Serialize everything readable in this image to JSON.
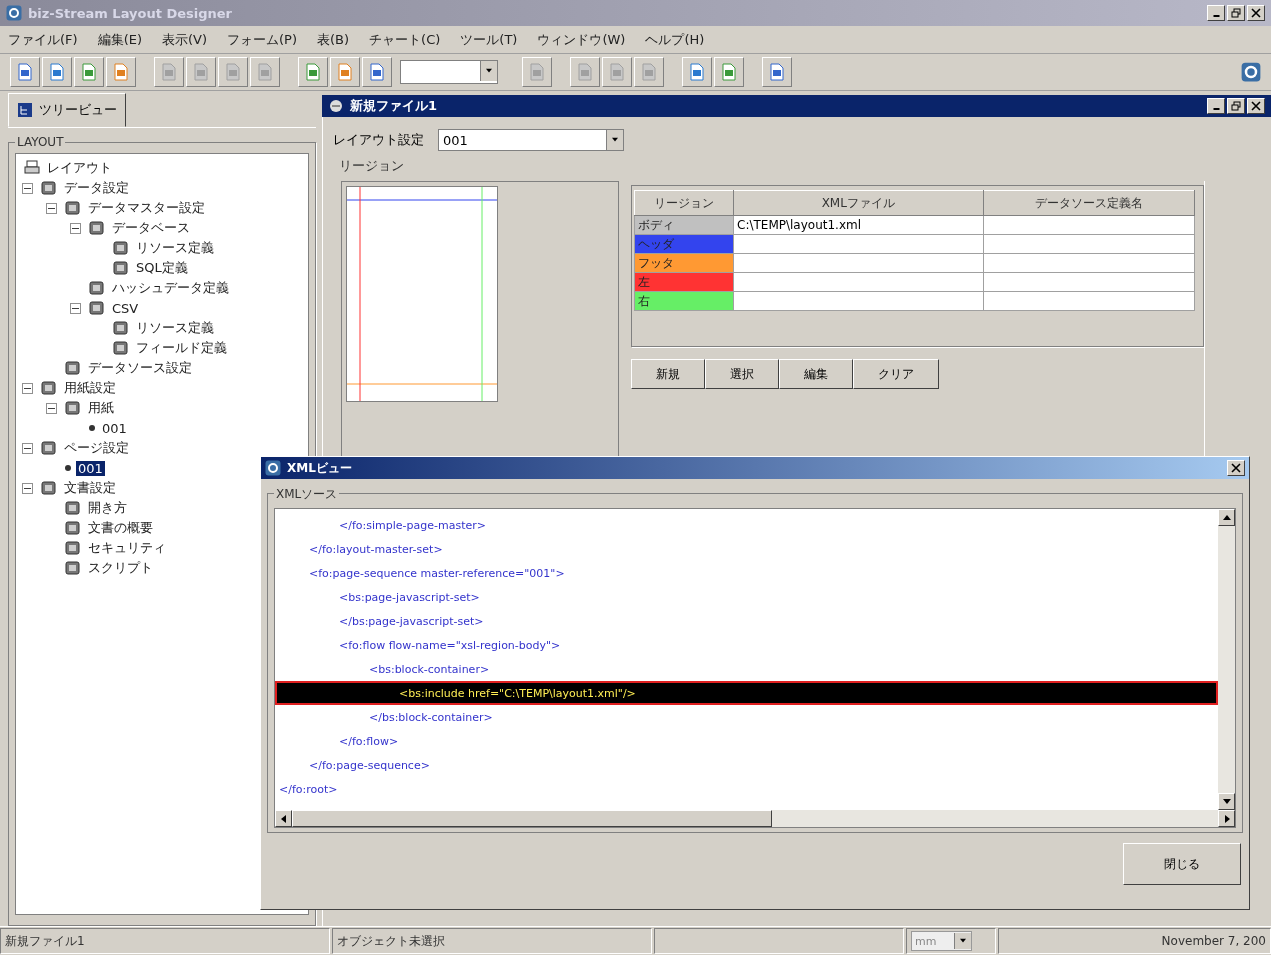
{
  "window": {
    "title": "biz-Stream Layout Designer"
  },
  "menu": [
    "ファイル(F)",
    "編集(E)",
    "表示(V)",
    "フォーム(P)",
    "表(B)",
    "チャート(C)",
    "ツール(T)",
    "ウィンドウ(W)",
    "ヘルプ(H)"
  ],
  "toolbar": [
    {
      "kind": "button",
      "disabled": false
    },
    {
      "kind": "button",
      "disabled": false
    },
    {
      "kind": "button",
      "disabled": false
    },
    {
      "kind": "button",
      "disabled": false
    },
    {
      "kind": "gap"
    },
    {
      "kind": "button",
      "disabled": true
    },
    {
      "kind": "button",
      "disabled": true
    },
    {
      "kind": "button",
      "disabled": true
    },
    {
      "kind": "button",
      "disabled": true
    },
    {
      "kind": "gap"
    },
    {
      "kind": "button",
      "disabled": false
    },
    {
      "kind": "button",
      "disabled": false
    },
    {
      "kind": "button",
      "disabled": false
    },
    {
      "kind": "combo"
    },
    {
      "kind": "gap"
    },
    {
      "kind": "button",
      "disabled": true
    },
    {
      "kind": "gap"
    },
    {
      "kind": "button",
      "disabled": true
    },
    {
      "kind": "button",
      "disabled": true
    },
    {
      "kind": "button",
      "disabled": true
    },
    {
      "kind": "gap"
    },
    {
      "kind": "button",
      "disabled": false
    },
    {
      "kind": "button",
      "disabled": false
    },
    {
      "kind": "gap"
    },
    {
      "kind": "button",
      "disabled": false
    }
  ],
  "tree_panel": {
    "tab": "ツリービュー",
    "group": "LAYOUT",
    "items": [
      {
        "label": "レイアウト",
        "kind": "root",
        "selected": false
      },
      {
        "label": "データ設定",
        "kind": "node",
        "selected": false,
        "expanded": true,
        "children": [
          {
            "label": "データマスター設定",
            "kind": "node",
            "selected": false,
            "expanded": true,
            "children": [
              {
                "label": "データベース",
                "kind": "node",
                "selected": false,
                "expanded": true,
                "children": [
                  {
                    "label": "リソース定義",
                    "kind": "node",
                    "selected": false
                  },
                  {
                    "label": "SQL定義",
                    "kind": "node",
                    "selected": false
                  }
                ]
              },
              {
                "label": "ハッシュデータ定義",
                "kind": "node",
                "selected": false
              },
              {
                "label": "CSV",
                "kind": "node",
                "selected": false,
                "expanded": true,
                "children": [
                  {
                    "label": "リソース定義",
                    "kind": "node",
                    "selected": false
                  },
                  {
                    "label": "フィールド定義",
                    "kind": "node",
                    "selected": false
                  }
                ]
              }
            ]
          },
          {
            "label": "データソース設定",
            "kind": "node",
            "selected": false
          }
        ]
      },
      {
        "label": "用紙設定",
        "kind": "node",
        "selected": false,
        "expanded": true,
        "children": [
          {
            "label": "用紙",
            "kind": "node",
            "selected": false,
            "expanded": true,
            "children": [
              {
                "label": "001",
                "kind": "bullet",
                "selected": false
              }
            ]
          }
        ]
      },
      {
        "label": "ページ設定",
        "kind": "node",
        "selected": false,
        "expanded": true,
        "children": [
          {
            "label": "001",
            "kind": "bullet",
            "selected": true
          }
        ]
      },
      {
        "label": "文書設定",
        "kind": "node",
        "selected": false,
        "expanded": true,
        "children": [
          {
            "label": "開き方",
            "kind": "node",
            "selected": false
          },
          {
            "label": "文書の概要",
            "kind": "node",
            "selected": false
          },
          {
            "label": "セキュリティ",
            "kind": "node",
            "selected": false
          },
          {
            "label": "スクリプト",
            "kind": "node",
            "selected": false
          }
        ]
      }
    ]
  },
  "document": {
    "title": "新規ファイル1",
    "layout_label": "レイアウト設定",
    "layout_value": "001",
    "region_group": "リージョン",
    "table": {
      "columns": [
        "リージョン",
        "XMLファイル",
        "データソース定義名"
      ],
      "rows": [
        {
          "region": "ボディ",
          "color": "#c0c0c0",
          "xml_file": "C:\\TEMP\\layout1.xml"
        },
        {
          "region": "ヘッダ",
          "color": "#3344ee"
        },
        {
          "region": "フッタ",
          "color": "#ff9933"
        },
        {
          "region": "左",
          "color": "#ff3333"
        },
        {
          "region": "右",
          "color": "#66ee66"
        }
      ]
    },
    "buttons": [
      "新規",
      "選択",
      "編集",
      "クリア"
    ]
  },
  "xml_view": {
    "title": "XMLビュー",
    "group": "XMLソース",
    "lines": [
      {
        "children": [
          {
            "children": [
              {
                "text": "</fo:simple-page-master>",
                "selected": false
              }
            ]
          },
          {
            "text": "</fo:layout-master-set>",
            "selected": false
          },
          {
            "text": "<fo:page-sequence master-reference=\"001\">",
            "selected": false,
            "children": [
              {
                "text": "<bs:page-javascript-set>",
                "selected": false
              },
              {
                "text": "</bs:page-javascript-set>",
                "selected": false
              },
              {
                "text": "<fo:flow flow-name=\"xsl-region-body\">",
                "selected": false,
                "children": [
                  {
                    "text": "<bs:block-container>",
                    "selected": false,
                    "children": [
                      {
                        "text": "<bs:include href=\"C:\\TEMP\\layout1.xml\"/>",
                        "selected": true
                      }
                    ]
                  },
                  {
                    "text": "</bs:block-container>",
                    "selected": false
                  }
                ]
              },
              {
                "text": "</fo:flow>",
                "selected": false
              }
            ]
          },
          {
            "text": "</fo:page-sequence>",
            "selected": false
          }
        ]
      },
      {
        "text": "</fo:root>",
        "selected": false
      }
    ],
    "close_button": "閉じる"
  },
  "status_bar": {
    "file": "新規ファイル1",
    "selection": "オブジェクト未選択",
    "unit": "mm",
    "date": "November 7, 200"
  }
}
